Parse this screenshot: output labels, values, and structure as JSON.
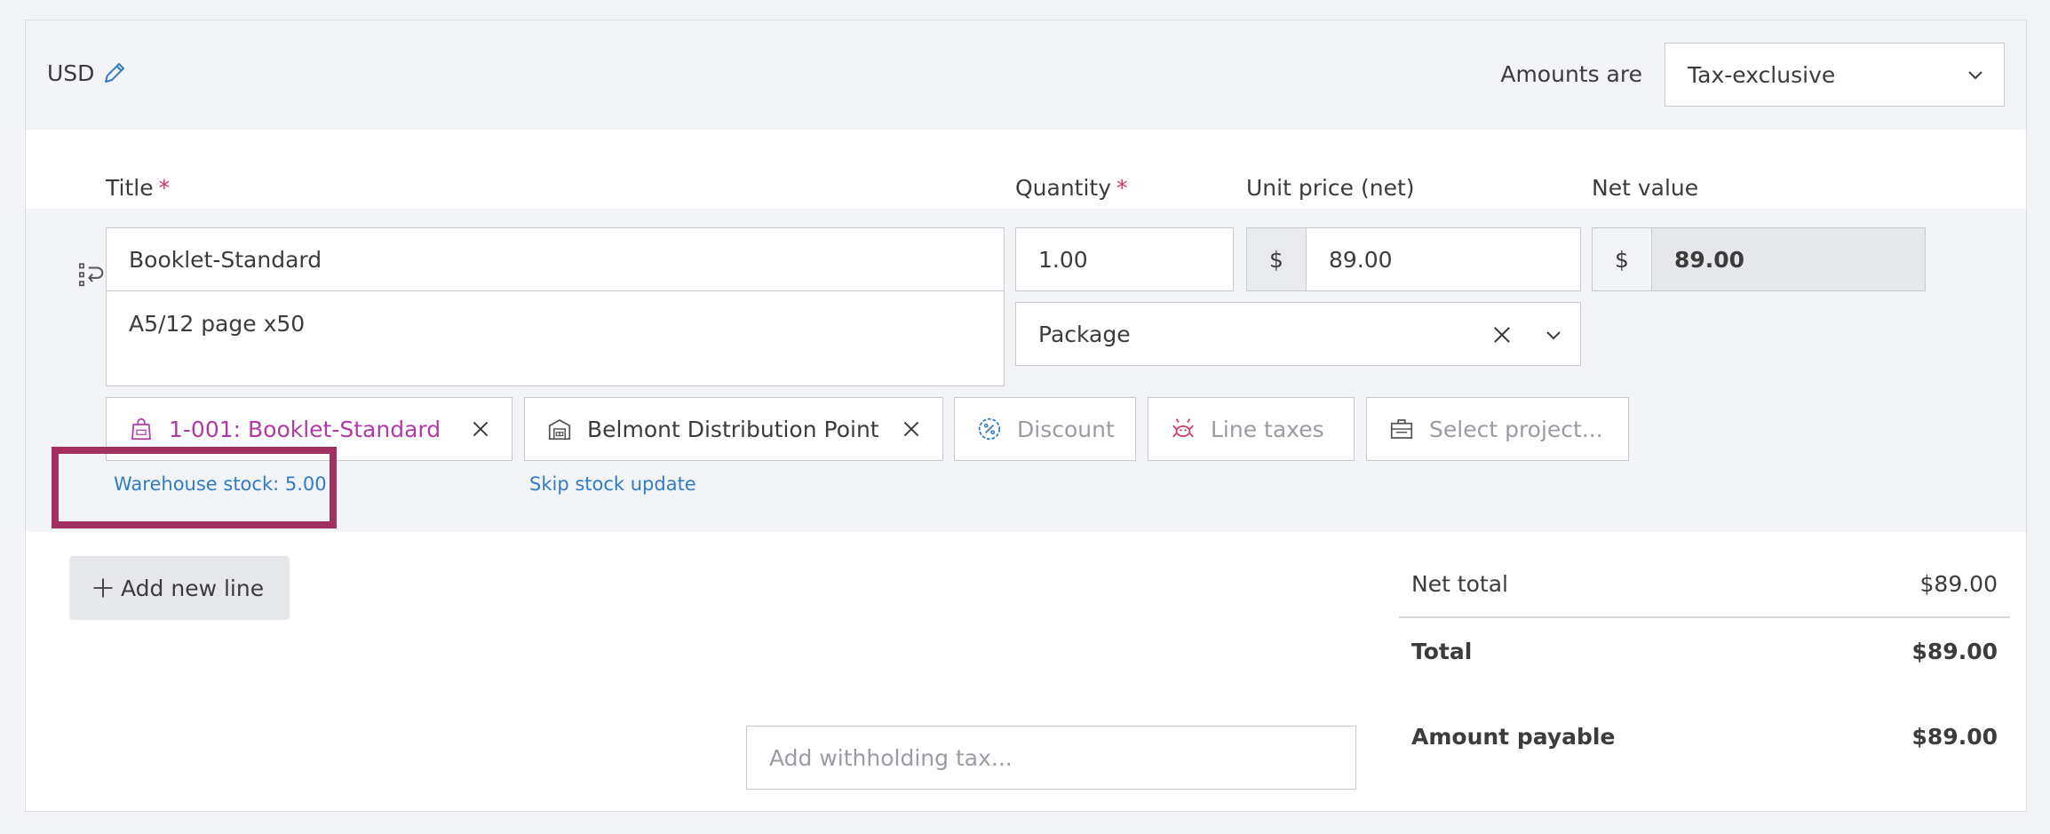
{
  "currency": {
    "code": "USD"
  },
  "amounts": {
    "label": "Amounts are",
    "selected": "Tax-exclusive"
  },
  "columns": {
    "title": "Title",
    "quantity": "Quantity",
    "unit_price": "Unit price (net)",
    "net_value": "Net value",
    "required_mark": "*"
  },
  "line": {
    "title": "Booklet-Standard",
    "description": "A5/12 page x50",
    "quantity": "1.00",
    "unit": "Package",
    "currency_symbol": "$",
    "unit_price": "89.00",
    "net_value": "89.00",
    "product_chip": "1-001: Booklet-Standard",
    "warehouse_chip": "Belmont Distribution Point",
    "discount": "Discount",
    "line_taxes": "Line taxes",
    "project_placeholder": "Select project...",
    "warehouse_stock": "Warehouse stock: 5.00",
    "skip_stock": "Skip stock update"
  },
  "actions": {
    "add_line": "Add new line"
  },
  "withholding": {
    "placeholder": "Add withholding tax..."
  },
  "totals": {
    "net_total_label": "Net total",
    "net_total_value": "$89.00",
    "total_label": "Total",
    "total_value": "$89.00",
    "payable_label": "Amount payable",
    "payable_value": "$89.00"
  },
  "colors": {
    "accent_link": "#2f7cc8",
    "product_chip": "#b23aa8",
    "highlight_border": "#a23060",
    "required": "#d0365f"
  }
}
